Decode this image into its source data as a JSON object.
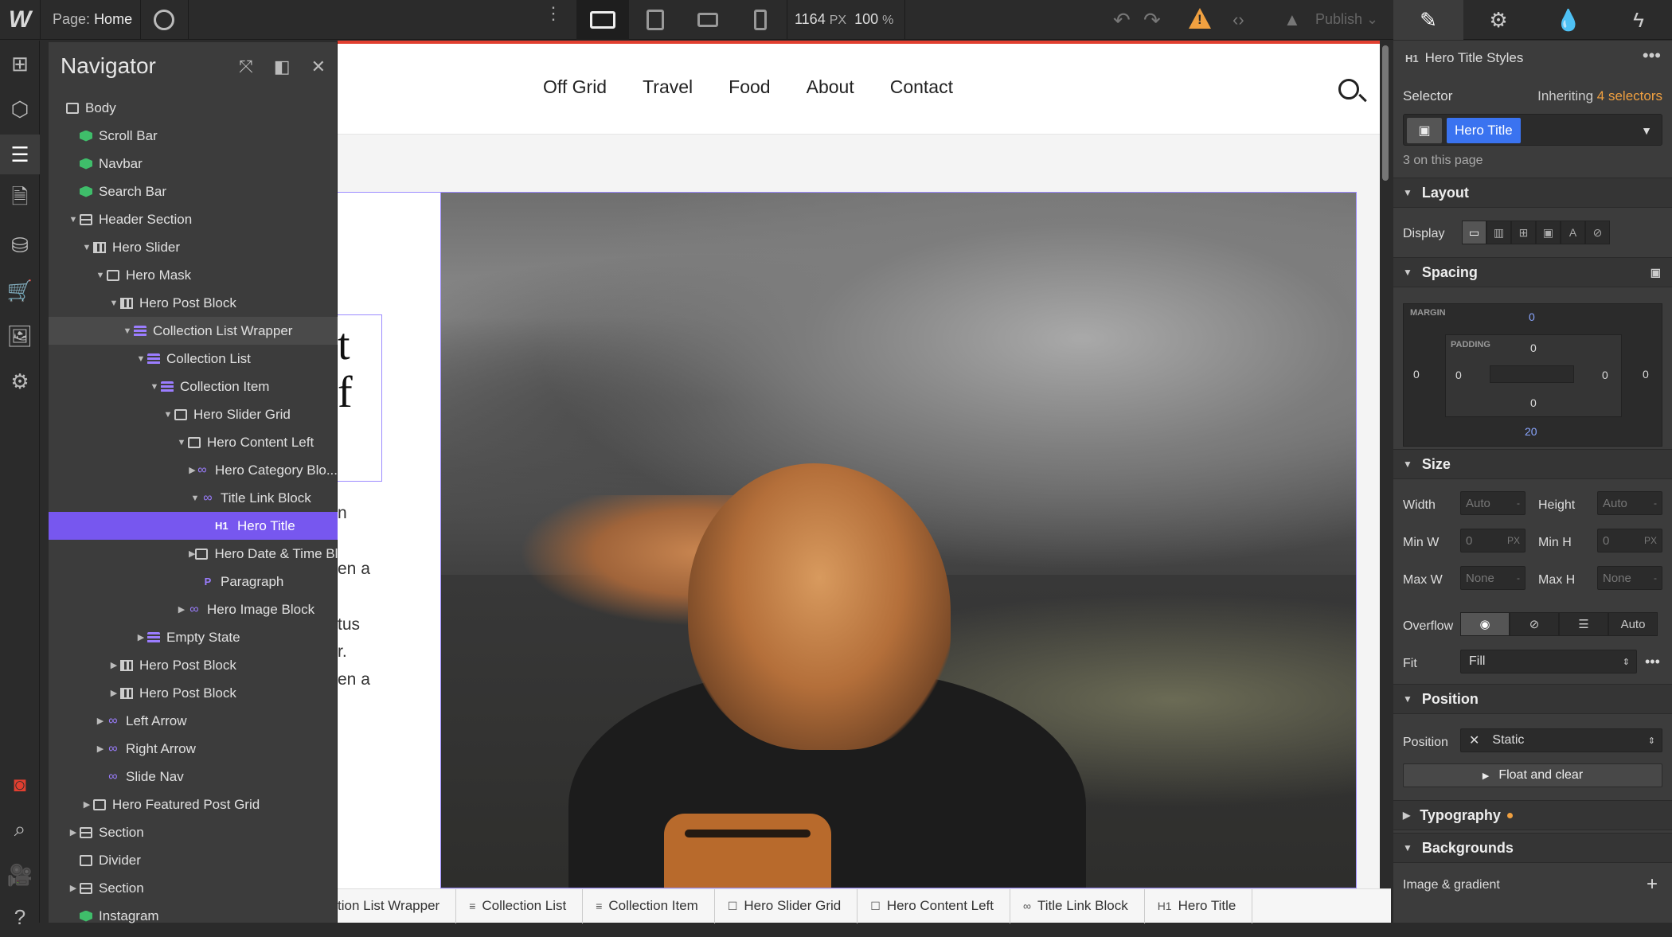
{
  "topbar": {
    "logo": "W",
    "page_label": "Page:",
    "page_name": "Home",
    "canvas_width": "1164",
    "canvas_width_unit": "PX",
    "zoom": "100",
    "zoom_unit": "%",
    "publish_label": "Publish"
  },
  "navigator": {
    "title": "Navigator",
    "items": [
      {
        "label": "Body",
        "depth": 0,
        "icon": "body-icon",
        "caret": ""
      },
      {
        "label": "Scroll Bar",
        "depth": 1,
        "icon": "symbol-cube-icon",
        "caret": ""
      },
      {
        "label": "Navbar",
        "depth": 1,
        "icon": "symbol-cube-icon",
        "caret": ""
      },
      {
        "label": "Search Bar",
        "depth": 1,
        "icon": "symbol-cube-icon",
        "caret": ""
      },
      {
        "label": "Header Section",
        "depth": 1,
        "icon": "section-icon",
        "caret": "open"
      },
      {
        "label": "Hero Slider",
        "depth": 2,
        "icon": "slider-icon",
        "caret": "open"
      },
      {
        "label": "Hero Mask",
        "depth": 3,
        "icon": "mask-icon",
        "caret": "open"
      },
      {
        "label": "Hero Post Block",
        "depth": 4,
        "icon": "slide-icon",
        "caret": "open"
      },
      {
        "label": "Collection List Wrapper",
        "depth": 5,
        "icon": "collection-icon",
        "caret": "open",
        "state": "highlight"
      },
      {
        "label": "Collection List",
        "depth": 6,
        "icon": "collection-icon",
        "caret": "open"
      },
      {
        "label": "Collection Item",
        "depth": 7,
        "icon": "collection-icon",
        "caret": "open"
      },
      {
        "label": "Hero Slider Grid",
        "depth": 8,
        "icon": "box-icon",
        "caret": "open"
      },
      {
        "label": "Hero Content Left",
        "depth": 9,
        "icon": "box-icon",
        "caret": "open"
      },
      {
        "label": "Hero Category Blo...",
        "depth": 10,
        "icon": "link-icon",
        "caret": "closed"
      },
      {
        "label": "Title Link Block",
        "depth": 10,
        "icon": "link-icon",
        "caret": "open"
      },
      {
        "label": "Hero Title",
        "depth": 11,
        "icon": "heading-icon",
        "caret": "",
        "state": "selected"
      },
      {
        "label": "Hero Date & Time Bl",
        "depth": 10,
        "icon": "box-icon",
        "caret": "closed"
      },
      {
        "label": "Paragraph",
        "depth": 10,
        "icon": "paragraph-icon",
        "caret": ""
      },
      {
        "label": "Hero Image Block",
        "depth": 9,
        "icon": "link-icon",
        "caret": "closed"
      },
      {
        "label": "Empty State",
        "depth": 6,
        "icon": "collection-icon",
        "caret": "closed"
      },
      {
        "label": "Hero Post Block",
        "depth": 4,
        "icon": "slide-icon",
        "caret": "closed"
      },
      {
        "label": "Hero Post Block",
        "depth": 4,
        "icon": "slide-icon",
        "caret": "closed"
      },
      {
        "label": "Left Arrow",
        "depth": 3,
        "icon": "link-icon",
        "caret": "closed"
      },
      {
        "label": "Right Arrow",
        "depth": 3,
        "icon": "link-icon",
        "caret": "closed"
      },
      {
        "label": "Slide Nav",
        "depth": 3,
        "icon": "link-icon",
        "caret": ""
      },
      {
        "label": "Hero Featured Post Grid",
        "depth": 2,
        "icon": "box-icon",
        "caret": "closed"
      },
      {
        "label": "Section",
        "depth": 1,
        "icon": "section-icon",
        "caret": "closed"
      },
      {
        "label": "Divider",
        "depth": 1,
        "icon": "box-icon",
        "caret": ""
      },
      {
        "label": "Section",
        "depth": 1,
        "icon": "section-icon",
        "caret": "closed"
      },
      {
        "label": "Instagram",
        "depth": 1,
        "icon": "symbol-cube-icon",
        "caret": ""
      }
    ]
  },
  "site": {
    "menu": [
      "Off Grid",
      "Travel",
      "Food",
      "About",
      "Contact"
    ],
    "hero_title_fragment": [
      "t",
      "f"
    ],
    "text_fragments": [
      "n",
      "en a",
      "tus",
      "r.",
      "en a"
    ]
  },
  "breadcrumb": [
    {
      "label": "tion List Wrapper",
      "icon": "collection-icon"
    },
    {
      "label": "Collection List",
      "icon": "collection-icon"
    },
    {
      "label": "Collection Item",
      "icon": "collection-icon"
    },
    {
      "label": "Hero Slider Grid",
      "icon": "box-icon"
    },
    {
      "label": "Hero Content Left",
      "icon": "box-icon"
    },
    {
      "label": "Title Link Block",
      "icon": "link-icon"
    },
    {
      "label": "Hero Title",
      "icon": "heading-icon",
      "badge": "H1"
    }
  ],
  "style_panel": {
    "element_tag": "H1",
    "title": "Hero Title Styles",
    "selector_label": "Selector",
    "inheriting_prefix": "Inheriting",
    "inheriting_count": "4 selectors",
    "selector_chip": "Hero Title",
    "on_page": "3 on this page",
    "sections": {
      "layout": "Layout",
      "spacing": "Spacing",
      "size": "Size",
      "position": "Position",
      "typography": "Typography",
      "backgrounds": "Backgrounds"
    },
    "display_label": "Display",
    "spacing": {
      "margin_label": "MARGIN",
      "padding_label": "PADDING",
      "margin_top": "0",
      "margin_left": "0",
      "margin_right": "0",
      "margin_bottom": "20",
      "padding_top": "0",
      "padding_left": "0",
      "padding_right": "0",
      "padding_bottom": "0"
    },
    "size": {
      "width_label": "Width",
      "width_value": "Auto",
      "height_label": "Height",
      "height_value": "Auto",
      "minw_label": "Min W",
      "minw_value": "0",
      "minw_unit": "PX",
      "minh_label": "Min H",
      "minh_value": "0",
      "minh_unit": "PX",
      "maxw_label": "Max W",
      "maxw_value": "None",
      "maxh_label": "Max H",
      "maxh_value": "None",
      "unit_dash": "-",
      "overflow_label": "Overflow",
      "overflow_auto": "Auto",
      "fit_label": "Fit",
      "fit_value": "Fill"
    },
    "position": {
      "label": "Position",
      "value": "Static",
      "float_btn": "Float and clear"
    },
    "backgrounds": {
      "image_gradient": "Image & gradient"
    }
  },
  "colors": {
    "accent_purple": "#7757ef",
    "selector_blue": "#3a73f0",
    "warning_orange": "#f0a040",
    "canvas_red_line": "#e13f30"
  }
}
